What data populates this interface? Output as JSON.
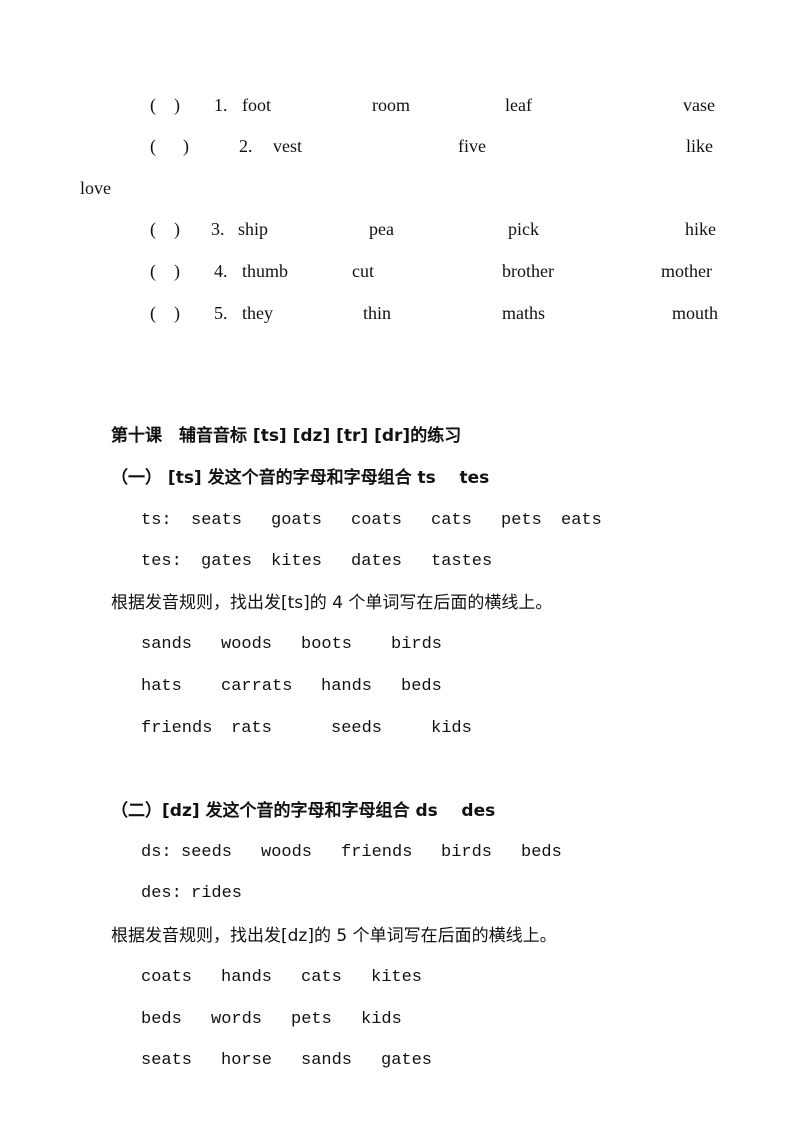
{
  "exercise_rows": [
    {
      "bracket": "(    )",
      "num": "1.",
      "words": [
        "foot",
        "room",
        "leaf",
        "vase"
      ]
    },
    {
      "bracket": "(      )",
      "num": "2.",
      "words": [
        "vest",
        "five",
        "like"
      ],
      "wrap": "love"
    },
    {
      "bracket": "(    )",
      "num": "3.",
      "words": [
        "ship",
        "pea",
        "pick",
        "hike"
      ]
    },
    {
      "bracket": "(    )",
      "num": "4.",
      "words": [
        "thumb",
        "cut",
        "brother",
        "mother"
      ]
    },
    {
      "bracket": "(    )",
      "num": "5.",
      "words": [
        "they",
        "thin",
        "maths",
        "mouth"
      ]
    }
  ],
  "lesson_title": "第十课　辅音音标 [ts] [dz] [tr] [dr]的练习",
  "part1": {
    "heading": "（一） [ts] 发这个音的字母和字母组合 ts    tes",
    "ts_label": "ts:",
    "ts_words": [
      "seats",
      "goats",
      "coats",
      "cats",
      "pets",
      "eats"
    ],
    "tes_label": "tes:",
    "tes_words": [
      "gates",
      "kites",
      "dates",
      "tastes"
    ],
    "instruction": "根据发音规则，找出发[ts]的 4 个单词写在后面的横线上。",
    "rows": [
      [
        "sands",
        "woods",
        "boots",
        "birds"
      ],
      [
        "hats",
        "carrats",
        "hands",
        "beds"
      ],
      [
        "friends",
        "rats",
        "seeds",
        "kids"
      ]
    ]
  },
  "part2": {
    "heading": "（二）[dz] 发这个音的字母和字母组合 ds    des",
    "ds_label": "ds:",
    "ds_words": [
      "seeds",
      "woods",
      "friends",
      "birds",
      "beds"
    ],
    "des_label": "des:",
    "des_words": [
      "rides"
    ],
    "instruction": "根据发音规则，找出发[dz]的 5 个单词写在后面的横线上。",
    "rows": [
      [
        "coats",
        "hands",
        "cats",
        "kites"
      ],
      [
        "beds",
        "words",
        "pets",
        "kids"
      ],
      [
        "seats",
        "horse",
        "sands",
        "gates"
      ]
    ]
  }
}
